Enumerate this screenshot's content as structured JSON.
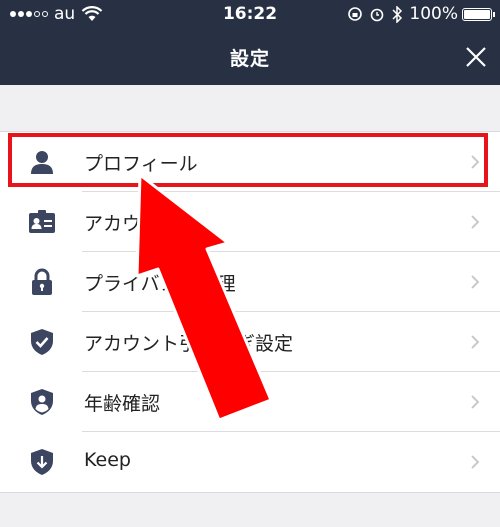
{
  "status": {
    "carrier": "au",
    "time": "16:22",
    "battery": "100%"
  },
  "header": {
    "title": "設定"
  },
  "menu": [
    {
      "label": "プロフィール",
      "icon": "person-icon"
    },
    {
      "label": "アカウント",
      "icon": "id-card-icon"
    },
    {
      "label": "プライバシー管理",
      "icon": "lock-icon"
    },
    {
      "label": "アカウント引き継ぎ設定",
      "icon": "shield-check-icon"
    },
    {
      "label": "年齢確認",
      "icon": "shield-person-icon"
    },
    {
      "label": "Keep",
      "icon": "keep-download-icon"
    }
  ],
  "colors": {
    "nav": "#283143",
    "highlight": "#e8141c",
    "icon": "#3c4660"
  }
}
